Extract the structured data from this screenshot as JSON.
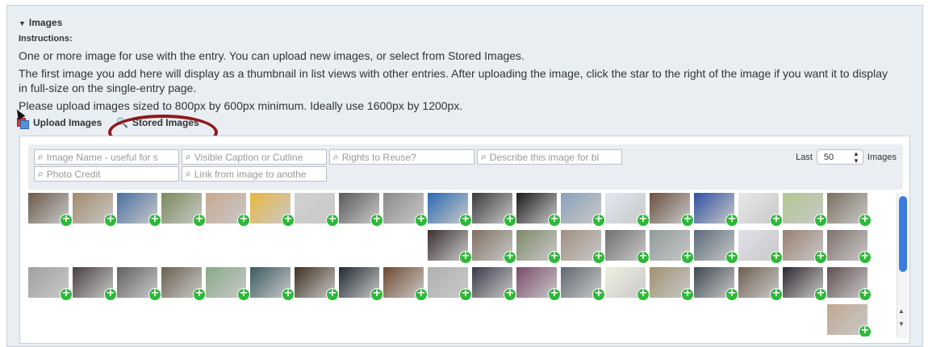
{
  "section": {
    "title": "Images"
  },
  "instructions": {
    "label": "Instructions:",
    "line1": "One or more image for use with the entry. You can upload new images, or select from Stored Images.",
    "line2": "The first image you add here will display as a thumbnail in list views with other entries. After uploading the image, click the star to the right of the image if you want it to display in full-size on the single-entry page.",
    "line3": "Please upload images sized to 800px by 600px minimum. Ideally use 1600px by 1200px."
  },
  "tabs": {
    "upload": "Upload Images",
    "stored": "Stored Images"
  },
  "filters": {
    "image_name": "Image Name - useful for s",
    "caption": "Visible Caption or Cutline",
    "rights": "Rights to Reuse?",
    "describe": "Describe this image for bl",
    "credit": "Photo Credit",
    "link": "Link from image to anothe"
  },
  "pagination": {
    "last_label": "Last",
    "count": "50",
    "images_label": "Images"
  },
  "thumb_colors": [
    "#6b5a4a",
    "#a08a6a",
    "#4a6fa0",
    "#7a8a5a",
    "#c8a890",
    "#e8b840",
    "#d0d0d0",
    "#5a5a5a",
    "#8a8a8a",
    "#2a6ab0",
    "#3a3a3a",
    "#1a1a1a",
    "#8aa0b8",
    "#e0e8f0",
    "#6a5040",
    "#3050a0",
    "#e8e8e8",
    "#b0c890",
    "#7a7060",
    "#3a3030",
    "#807060",
    "#808a6a",
    "#a09080",
    "#707070",
    "#909a9a",
    "#5a6a7a",
    "#e0e0e8",
    "#9a8070",
    "#80706a",
    "#a0a0a0",
    "#4a4040",
    "#606060",
    "#6a6050",
    "#88aa88",
    "#3a5a60",
    "#403020",
    "#202830",
    "#704a30",
    "#b0b0b0",
    "#3a3a4a",
    "#7a4a6a",
    "#606870",
    "#f0f0e0",
    "#a09070",
    "#404850",
    "#706050",
    "#302830",
    "#605050",
    "#c0a890",
    "#5a8040"
  ]
}
